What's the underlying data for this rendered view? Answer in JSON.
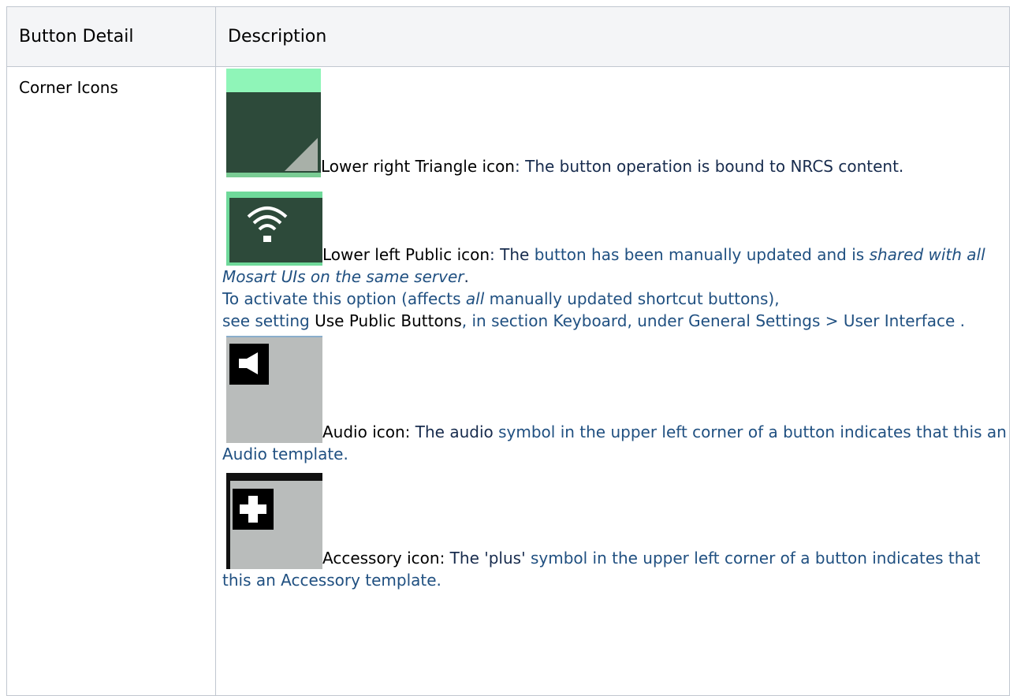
{
  "table": {
    "headers": [
      "Button Detail",
      "Description"
    ],
    "row": {
      "name": "Corner Icons",
      "items": {
        "triangle": {
          "title": "Lower right Triangle icon",
          "text": ": The button operation is bound to NRCS content."
        },
        "public": {
          "title": "Lower left Public icon",
          "text_1": ": The ",
          "text_2": "button has been manually updated and is ",
          "italic": "shared with all Mosart UIs on the same server",
          "text_3": ".",
          "line2_a": "To activate this option (affects ",
          "line2_all": "all",
          "line2_b": " manually updated shortcut buttons),",
          "line3_a": "see setting ",
          "line3_setting": "Use Public Buttons",
          "line3_b": ", in section ",
          "link_keyboard": "Keyboard",
          "line3_c": ", under ",
          "link_general": "General Settings > User Interface",
          "line3_d": " ."
        },
        "audio": {
          "title": "Audio icon:",
          "text_a": " The audio ",
          "text_b": "symbol in the upper left corner of a button indicates that this an Audio template."
        },
        "accessory": {
          "title": "Accessory icon:",
          "text_a": " The 'plus' ",
          "text_b": "symbol in the upper left corner of a button indicates that this an Accessory template."
        }
      }
    }
  },
  "icons": {
    "triangle": "lower-right-triangle-icon",
    "public": "wifi-public-icon",
    "audio": "speaker-audio-icon",
    "accessory": "plus-accessory-icon"
  }
}
